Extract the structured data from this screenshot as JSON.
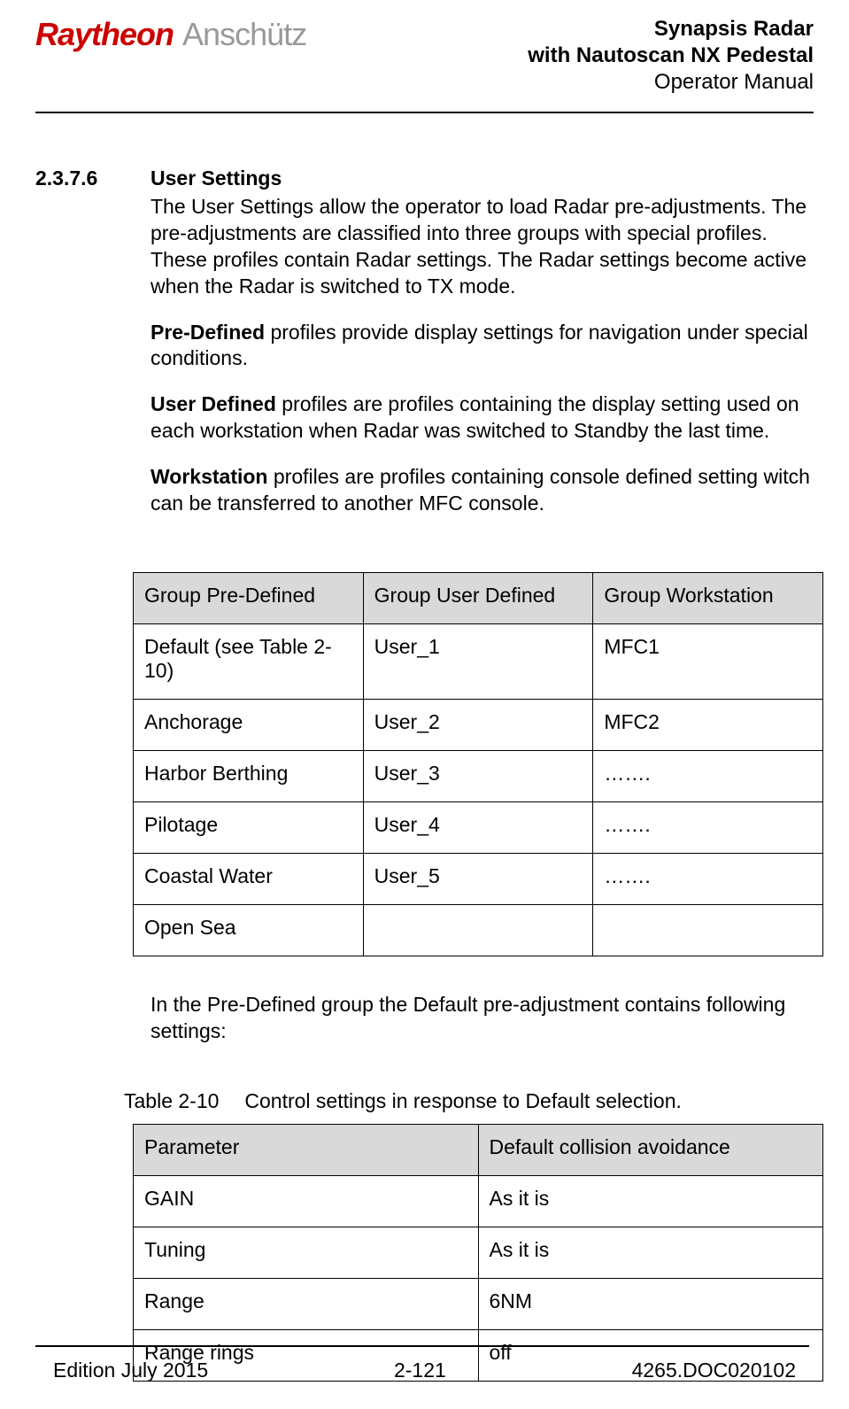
{
  "header": {
    "logo_brand": "Raytheon",
    "logo_sub": "Anschütz",
    "title_line1": "Synapsis Radar",
    "title_line2": "with Nautoscan NX Pedestal",
    "title_line3": "Operator Manual"
  },
  "section": {
    "number": "2.3.7.6",
    "title": "User Settings",
    "intro": "The User Settings allow the operator to load Radar pre-adjustments. The pre-adjustments are classified into three groups with special profiles. These profiles contain Radar settings. The Radar settings become active when the Radar is switched to TX mode.",
    "pre_defined_label": "Pre-Defined",
    "pre_defined_text": " profiles provide display settings for navigation under special conditions.",
    "user_defined_label": "User Defined",
    "user_defined_text": " profiles are profiles containing the display setting used on each workstation when Radar was switched to Standby the last time.",
    "workstation_label": "Workstation",
    "workstation_text": " profiles are profiles containing console defined setting witch can be transferred to another MFC console."
  },
  "table1": {
    "headers": [
      "Group Pre-Defined",
      "Group User Defined",
      "Group Workstation"
    ],
    "rows": [
      [
        "Default (see Table 2-10)",
        "User_1",
        "MFC1"
      ],
      [
        "Anchorage",
        "User_2",
        "MFC2"
      ],
      [
        "Harbor Berthing",
        "User_3",
        "……."
      ],
      [
        "Pilotage",
        "User_4",
        "……."
      ],
      [
        "Coastal Water",
        "User_5",
        "……."
      ],
      [
        "Open Sea",
        "",
        ""
      ]
    ]
  },
  "note_after_t1": "In the Pre-Defined group the Default pre-adjustment contains following settings:",
  "caption": {
    "num": "Table 2-10",
    "text": "Control settings in response to Default selection."
  },
  "table2": {
    "headers": [
      "Parameter",
      "Default collision avoidance"
    ],
    "rows": [
      [
        "GAIN",
        "As it is"
      ],
      [
        "Tuning",
        "As it is"
      ],
      [
        "Range",
        "6NM"
      ],
      [
        "Range rings",
        "off"
      ]
    ]
  },
  "footer": {
    "left": "Edition July 2015",
    "center": "2-121",
    "right": "4265.DOC020102"
  }
}
